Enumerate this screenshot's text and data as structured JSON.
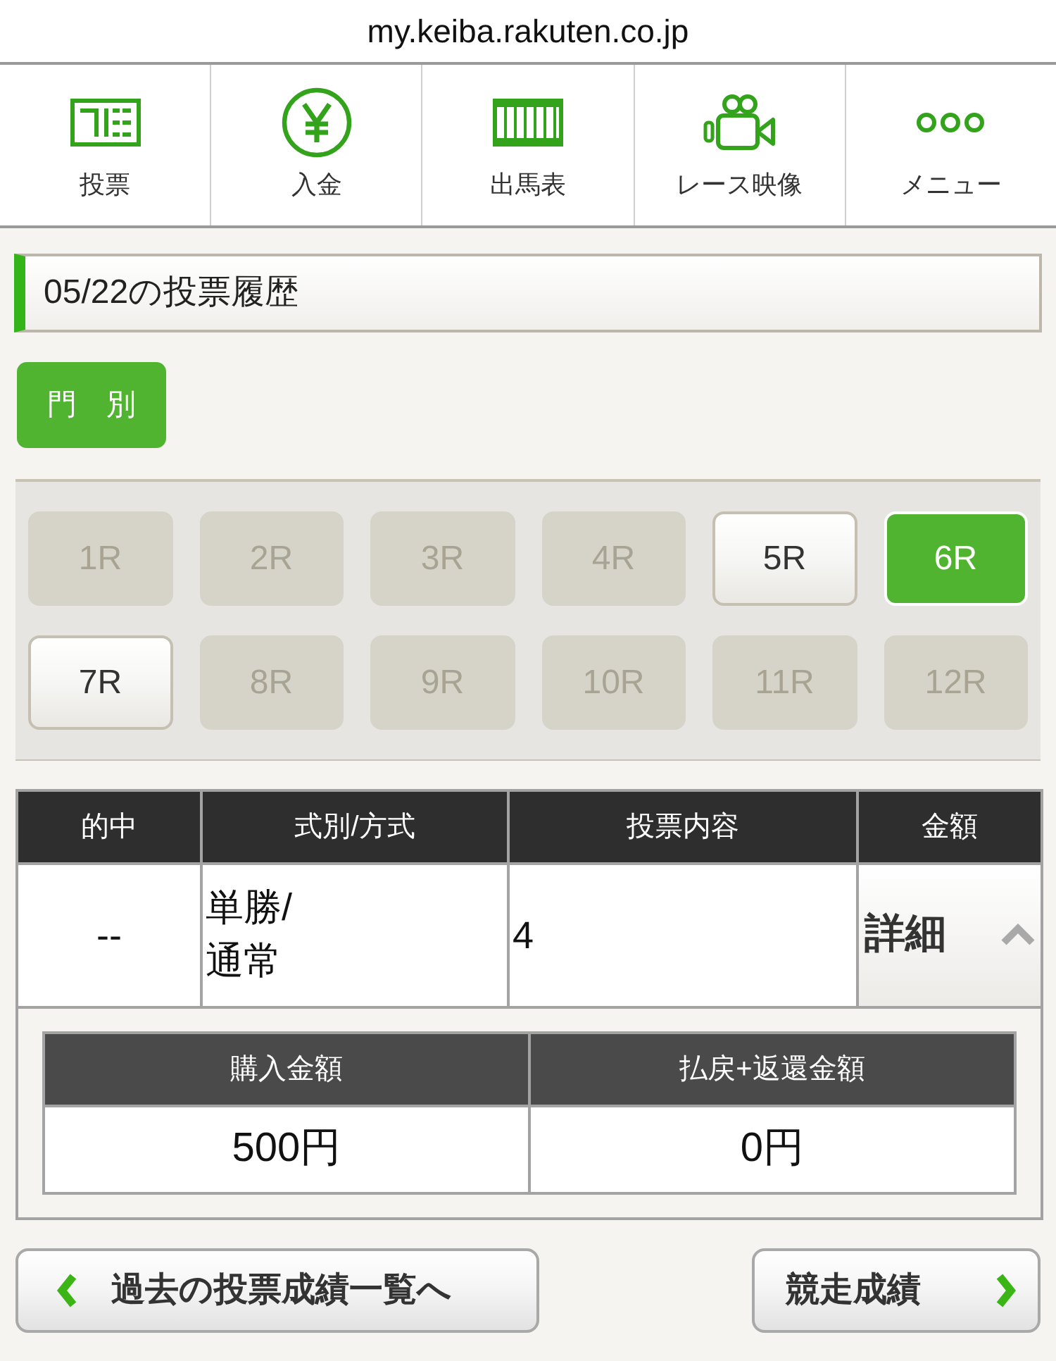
{
  "browser": {
    "url": "my.keiba.rakuten.co.jp"
  },
  "nav": [
    {
      "label": "投票"
    },
    {
      "label": "入金"
    },
    {
      "label": "出馬表"
    },
    {
      "label": "レース映像"
    },
    {
      "label": "メニュー"
    }
  ],
  "page_title": "05/22の投票履歴",
  "filter_button": {
    "label": "門　別"
  },
  "races": [
    {
      "label": "1R",
      "disabled": true,
      "selected": false
    },
    {
      "label": "2R",
      "disabled": true,
      "selected": false
    },
    {
      "label": "3R",
      "disabled": true,
      "selected": false
    },
    {
      "label": "4R",
      "disabled": true,
      "selected": false
    },
    {
      "label": "5R",
      "disabled": false,
      "selected": false
    },
    {
      "label": "6R",
      "disabled": false,
      "selected": true
    },
    {
      "label": "7R",
      "disabled": false,
      "selected": false
    },
    {
      "label": "8R",
      "disabled": true,
      "selected": false
    },
    {
      "label": "9R",
      "disabled": true,
      "selected": false
    },
    {
      "label": "10R",
      "disabled": true,
      "selected": false
    },
    {
      "label": "11R",
      "disabled": true,
      "selected": false
    },
    {
      "label": "12R",
      "disabled": true,
      "selected": false
    }
  ],
  "bets_table": {
    "columns": [
      "的中",
      "式別/方式",
      "投票内容",
      "金額"
    ],
    "rows": [
      {
        "hit": "--",
        "bet_type": "単勝/\n通常",
        "selection": "4",
        "detail": "詳細",
        "expanded": true,
        "summary": {
          "columns": [
            "購入金額",
            "払戻+返還金額"
          ],
          "values": [
            "500円",
            "0円"
          ]
        }
      }
    ]
  },
  "buttons": [
    {
      "label": "過去の投票成績一覧へ",
      "kind": "back"
    },
    {
      "label": "競走成績",
      "kind": "forward"
    }
  ]
}
